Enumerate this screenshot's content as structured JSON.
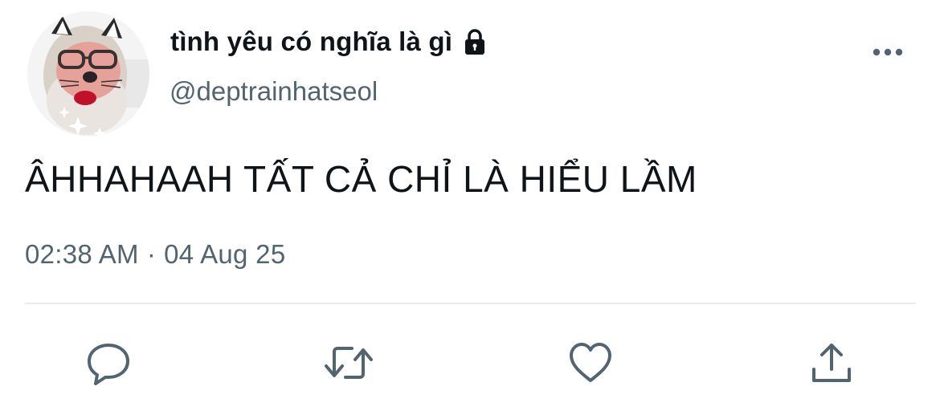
{
  "user": {
    "display_name": "tình yêu có nghĩa là gì",
    "handle": "@deptrainhatseol",
    "protected_icon": "lock-icon",
    "avatar_icon": "avatar-image"
  },
  "tweet": {
    "text": "ÂHHAHAAH TẤT CẢ CHỈ LÀ HIỂU LẦM",
    "time": "02:38 AM",
    "separator": "·",
    "date": "04 Aug 25"
  },
  "actions": {
    "reply_icon": "reply-icon",
    "retweet_icon": "retweet-icon",
    "like_icon": "heart-icon",
    "share_icon": "share-icon",
    "more_icon": "more-dots-icon"
  },
  "colors": {
    "text_primary": "#0f1419",
    "text_secondary": "#536471",
    "icon": "#536471",
    "divider": "#e6ecf0"
  }
}
